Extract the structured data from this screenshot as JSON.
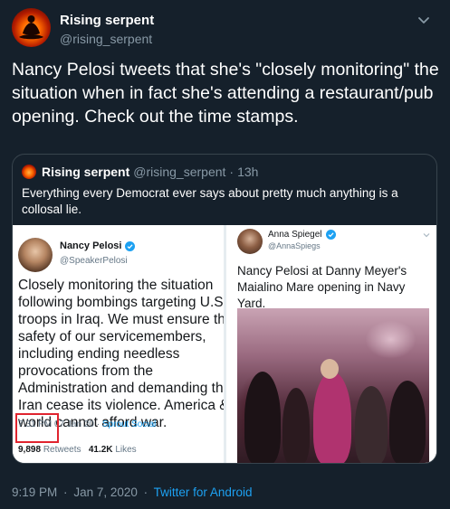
{
  "author": {
    "name": "Rising serpent",
    "handle": "@rising_serpent"
  },
  "tweet_text": "Nancy Pelosi tweets that she's \"closely monitoring\" the situation when in fact she's attending a restaurant/pub opening. Check out the time stamps.",
  "quoted": {
    "name": "Rising serpent",
    "handle": "@rising_serpent",
    "separator": "·",
    "time": "13h",
    "text": "Everything every Democrat ever says about pretty much anything is a collosal lie."
  },
  "media_left": {
    "name": "Nancy Pelosi",
    "handle": "@SpeakerPelosi",
    "body": "Closely monitoring the situation following bombings targeting U.S. troops in Iraq. We must ensure the safety of our servicemembers, including ending needless provocations from the Administration and demanding that Iran cease its violence. America & world cannot afford war.",
    "time": "7:31 PM",
    "date": "07 Jan 20",
    "source": "Sprout Social",
    "retweets_count": "9,898",
    "retweets_label": "Retweets",
    "likes_count": "41.2K",
    "likes_label": "Likes"
  },
  "media_right": {
    "name": "Anna Spiegel",
    "handle": "@AnnaSpiegs",
    "body": "Nancy Pelosi at Danny Meyer's Maialino Mare opening in Navy Yard."
  },
  "footer": {
    "time": "9:19 PM",
    "separator": "·",
    "date": "Jan 7, 2020",
    "separator2": "·",
    "source": "Twitter for Android"
  },
  "colors": {
    "background": "#15202b",
    "secondary_text": "#8899a6",
    "link": "#1da1f2",
    "border": "#38444d",
    "highlight_box": "#e0242f"
  },
  "icons": {
    "more": "chevron-down-icon",
    "verified": "verified-badge-icon"
  }
}
